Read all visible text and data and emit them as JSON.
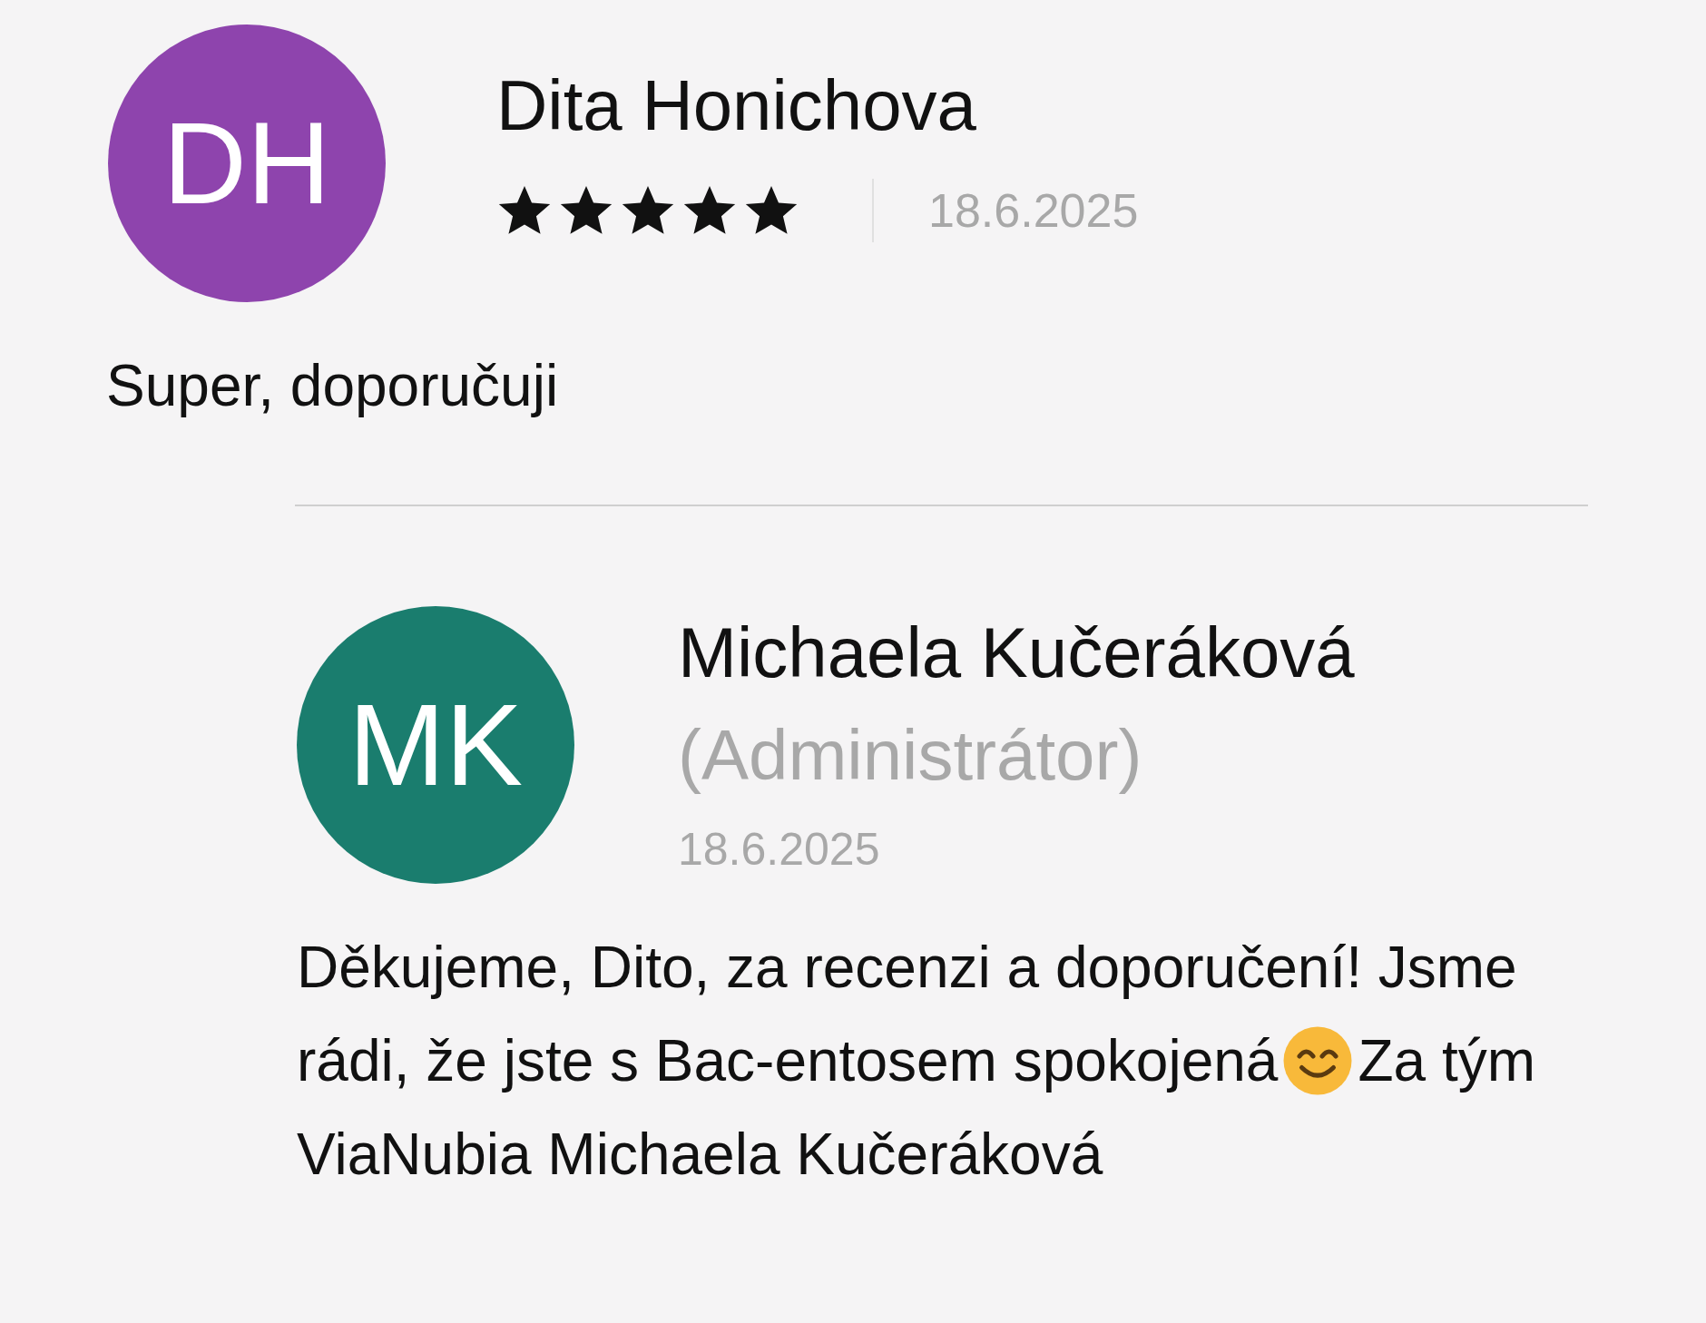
{
  "posts": [
    {
      "kind": "review",
      "initials": "DH",
      "color": "#8e44ad",
      "name": "Dita Honichova",
      "stars": 5,
      "date": "18.6.2025",
      "lines": [
        [
          {
            "kind": "text",
            "text": "Super, doporučuji"
          }
        ]
      ]
    },
    {
      "kind": "reply",
      "initials": "MK",
      "color": "#1a7d6e",
      "name": "Michaela Kučeráková",
      "role": "(Administrátor)",
      "date": "18.6.2025",
      "lines": [
        [
          {
            "kind": "text",
            "text": "Děkujeme, Dito, za recenzi a doporučení! Jsme"
          }
        ],
        [
          {
            "kind": "text",
            "text": "rádi, že jste s Bac-entosem spokojená"
          },
          {
            "kind": "emoji"
          },
          {
            "kind": "text",
            "text": "Za tým"
          }
        ],
        [
          {
            "kind": "text",
            "text": "ViaNubia Michaela Kučeráková"
          }
        ]
      ]
    }
  ]
}
